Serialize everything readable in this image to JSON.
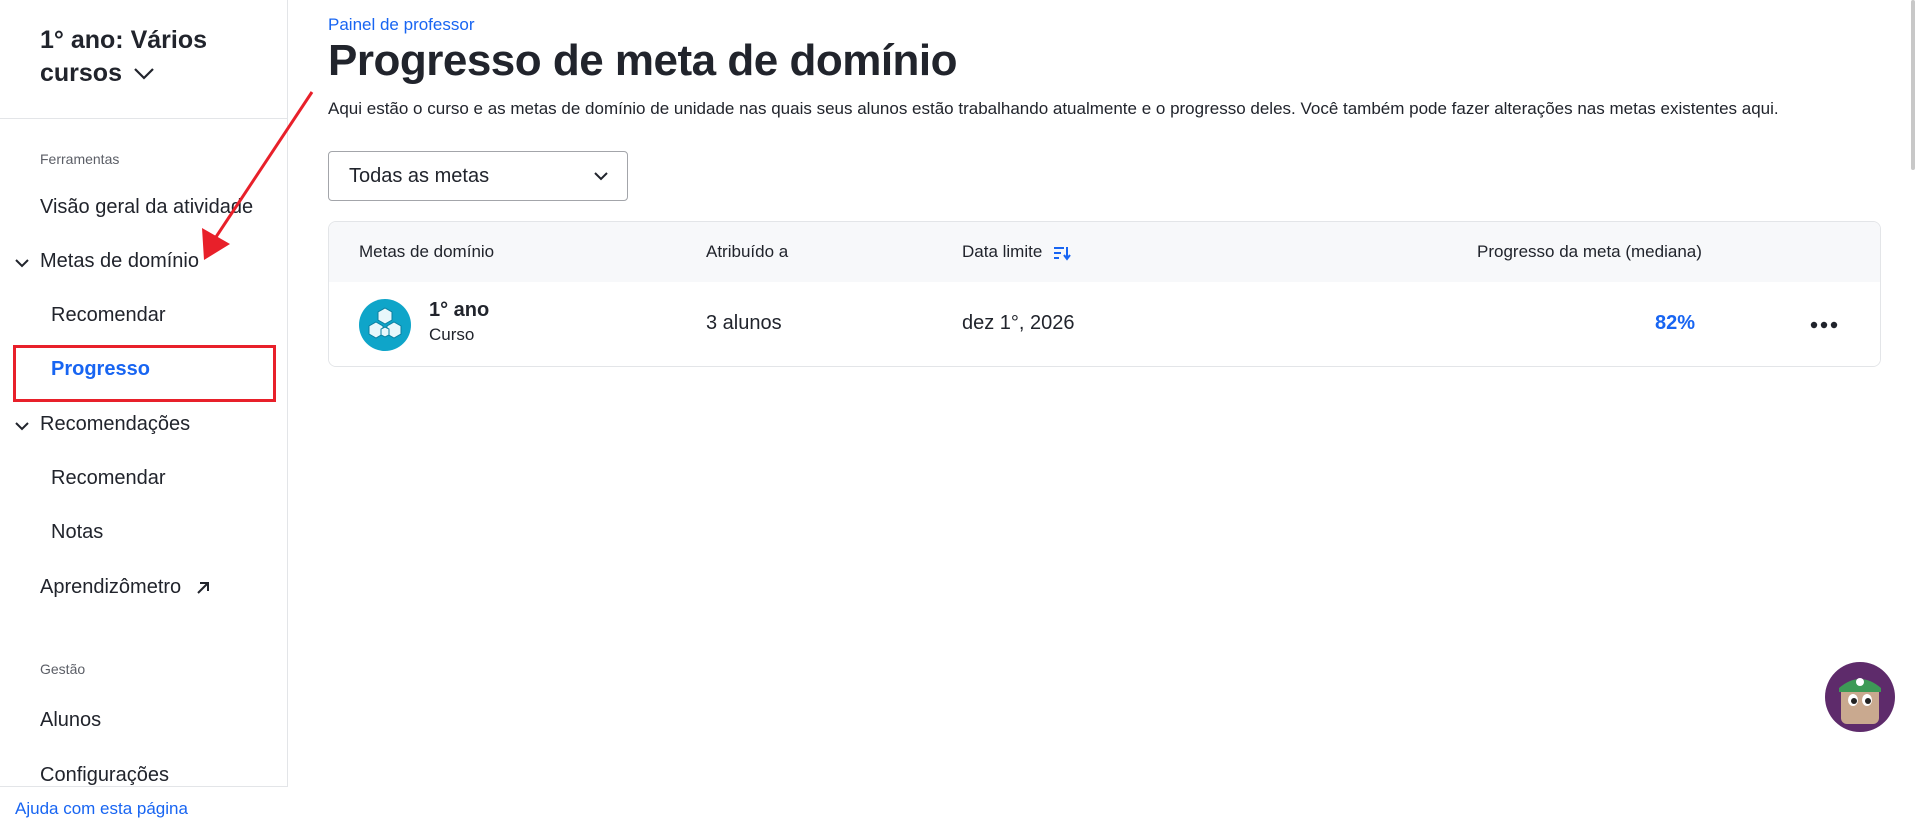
{
  "sidebar": {
    "course_title": "1° ano: Vários cursos",
    "section_tools": "Ferramentas",
    "items": [
      {
        "label": "Visão geral da atividade"
      },
      {
        "label": "Metas de domínio"
      },
      {
        "label": "Recomendar"
      },
      {
        "label": "Progresso"
      },
      {
        "label": "Recomendações"
      },
      {
        "label": "Recomendar"
      },
      {
        "label": "Notas"
      },
      {
        "label": "Aprendizômetro"
      }
    ],
    "section_management": "Gestão",
    "management_items": [
      {
        "label": "Alunos"
      },
      {
        "label": "Configurações"
      }
    ],
    "help_link": "Ajuda com esta página"
  },
  "header": {
    "breadcrumb": "Painel de professor",
    "title": "Progresso de meta de domínio",
    "description": "Aqui estão o curso e as metas de domínio de unidade nas quais seus alunos estão trabalhando atualmente e o progresso deles. Você também pode fazer alterações nas metas existentes aqui."
  },
  "filter": {
    "selected": "Todas as metas"
  },
  "table": {
    "columns": [
      "Metas de domínio",
      "Atribuído a",
      "Data limite",
      "Progresso da meta (mediana)"
    ],
    "rows": [
      {
        "title": "1° ano",
        "subtitle": "Curso",
        "assigned_to": "3 alunos",
        "due_date": "dez 1°, 2026",
        "progress": "82%"
      }
    ]
  },
  "colors": {
    "accent": "#1865f2",
    "highlight": "#e8202a",
    "course_icon": "#0fa5c9",
    "avatar_bg": "#5e2b6b"
  },
  "icons": [
    "chevron-down-icon",
    "external-link-icon",
    "sort-icon",
    "more-options-icon",
    "course-blocks-icon"
  ]
}
